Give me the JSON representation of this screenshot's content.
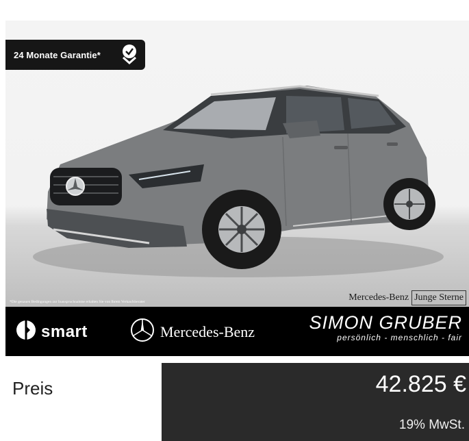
{
  "listing": {
    "warranty_badge": "24 Monate Garantie*",
    "disclaimer": "*Die genauen Bedingungen zur Inanspruchnahme erhalten Sie von Ihrem Verkaufsberater",
    "junge_sterne": {
      "brand": "Mercedes-Benz",
      "program": "Junge Sterne"
    },
    "brands": {
      "smart": "smart",
      "mercedes": "Mercedes-Benz",
      "dealer": "SIMON GRUBER",
      "dealer_slogan": "persönlich - menschlich - fair"
    },
    "price": {
      "label": "Preis",
      "value": "42.825 €",
      "vat": "19% MwSt."
    }
  },
  "icons": [
    "check-badge-icon",
    "smart-logo-icon",
    "mercedes-star-icon"
  ],
  "colors": {
    "car_body": "#7b7d7f",
    "bar_dark": "#000000",
    "price_box": "#2a2a2a"
  }
}
